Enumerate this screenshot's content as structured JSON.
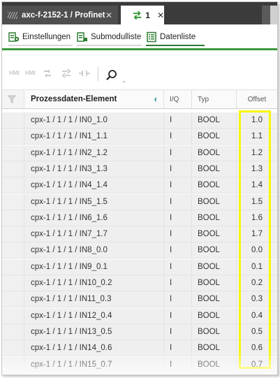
{
  "tabs": [
    {
      "label": "axc-f-2152-1 / Profinet"
    },
    {
      "label": "1"
    }
  ],
  "subtabs": [
    {
      "label": "Einstellungen"
    },
    {
      "label": "Submodulliste"
    },
    {
      "label": "Datenliste"
    }
  ],
  "toolbar": {
    "icons": [
      "HMI",
      "HMI",
      "",
      "",
      "",
      "search-icon"
    ]
  },
  "table": {
    "columns": [
      "",
      "Prozessdaten-Element",
      "I/Q",
      "Typ",
      "Offset"
    ],
    "rows": [
      {
        "element": "cpx-1 / 1 / 1 / IN0_1.0",
        "io": "I",
        "type": "BOOL",
        "offset": "1.0"
      },
      {
        "element": "cpx-1 / 1 / 1 / IN1_1.1",
        "io": "I",
        "type": "BOOL",
        "offset": "1.1"
      },
      {
        "element": "cpx-1 / 1 / 1 / IN2_1.2",
        "io": "I",
        "type": "BOOL",
        "offset": "1.2"
      },
      {
        "element": "cpx-1 / 1 / 1 / IN3_1.3",
        "io": "I",
        "type": "BOOL",
        "offset": "1.3"
      },
      {
        "element": "cpx-1 / 1 / 1 / IN4_1.4",
        "io": "I",
        "type": "BOOL",
        "offset": "1.4"
      },
      {
        "element": "cpx-1 / 1 / 1 / IN5_1.5",
        "io": "I",
        "type": "BOOL",
        "offset": "1.5"
      },
      {
        "element": "cpx-1 / 1 / 1 / IN6_1.6",
        "io": "I",
        "type": "BOOL",
        "offset": "1.6"
      },
      {
        "element": "cpx-1 / 1 / 1 / IN7_1.7",
        "io": "I",
        "type": "BOOL",
        "offset": "1.7"
      },
      {
        "element": "cpx-1 / 1 / 1 / IN8_0.0",
        "io": "I",
        "type": "BOOL",
        "offset": "0.0"
      },
      {
        "element": "cpx-1 / 1 / 1 / IN9_0.1",
        "io": "I",
        "type": "BOOL",
        "offset": "0.1"
      },
      {
        "element": "cpx-1 / 1 / 1 / IN10_0.2",
        "io": "I",
        "type": "BOOL",
        "offset": "0.2"
      },
      {
        "element": "cpx-1 / 1 / 1 / IN11_0.3",
        "io": "I",
        "type": "BOOL",
        "offset": "0.3"
      },
      {
        "element": "cpx-1 / 1 / 1 / IN12_0.4",
        "io": "I",
        "type": "BOOL",
        "offset": "0.4"
      },
      {
        "element": "cpx-1 / 1 / 1 / IN13_0.5",
        "io": "I",
        "type": "BOOL",
        "offset": "0.5"
      },
      {
        "element": "cpx-1 / 1 / 1 / IN14_0.6",
        "io": "I",
        "type": "BOOL",
        "offset": "0.6"
      },
      {
        "element": "cpx-1 / 1 / 1 / IN15_0.7",
        "io": "I",
        "type": "BOOL",
        "offset": "0.7"
      }
    ]
  },
  "colors": {
    "tabbar": "#3b3b3b",
    "accent_green": "#3c9a3c",
    "highlight": "#f7f70a",
    "teal": "#1a8a8a"
  }
}
